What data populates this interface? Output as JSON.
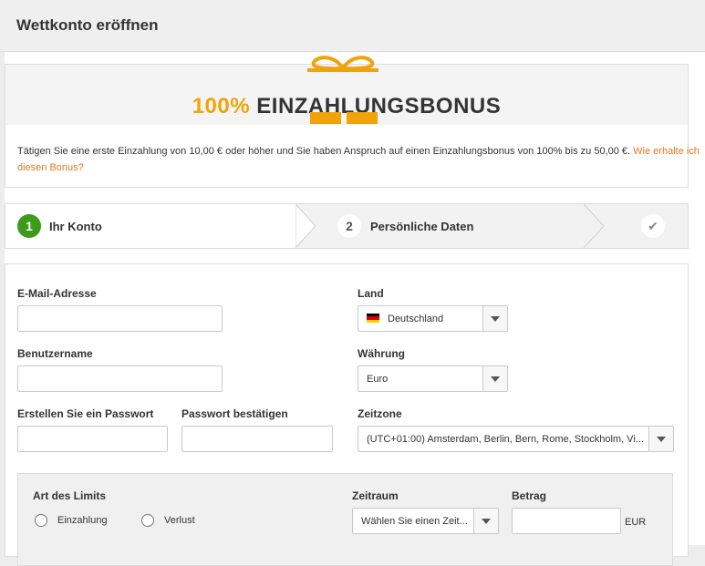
{
  "header": {
    "title": "Wettkonto eröffnen"
  },
  "banner": {
    "percent": "100%",
    "title": "EINZAHLUNGSBONUS",
    "accent_color": "#f0a30a"
  },
  "promo": {
    "text": "Tätigen Sie eine erste Einzahlung von 10,00 € oder höher und Sie haben Anspruch auf einen Einzahlungsbonus von 100% bis zu 50,00 €.",
    "link_text": "Wie erhalte ich diesen Bonus?",
    "link_color": "#e07b21"
  },
  "steps": [
    {
      "number": "1",
      "label": "Ihr Konto",
      "state": "active"
    },
    {
      "number": "2",
      "label": "Persönliche Daten",
      "state": "inactive"
    },
    {
      "icon": "checkmark-icon",
      "state": "inactive"
    }
  ],
  "form": {
    "email": {
      "label": "E-Mail-Adresse",
      "value": ""
    },
    "username": {
      "label": "Benutzername",
      "value": ""
    },
    "password": {
      "label": "Erstellen Sie ein Passwort",
      "value": ""
    },
    "password_confirm": {
      "label": "Passwort bestätigen",
      "value": ""
    },
    "country": {
      "label": "Land",
      "value": "Deutschland",
      "flag": "germany-flag-icon"
    },
    "currency": {
      "label": "Währung",
      "value": "Euro"
    },
    "timezone": {
      "label": "Zeitzone",
      "value": "(UTC+01:00) Amsterdam, Berlin, Bern, Rome, Stockholm, Vi..."
    }
  },
  "limits": {
    "type_label": "Art des Limits",
    "options": [
      "Einzahlung",
      "Verlust"
    ],
    "period_label": "Zeitraum",
    "period_value": "Wählen Sie einen Zeit...",
    "amount_label": "Betrag",
    "amount_value": "",
    "currency_code": "EUR"
  }
}
